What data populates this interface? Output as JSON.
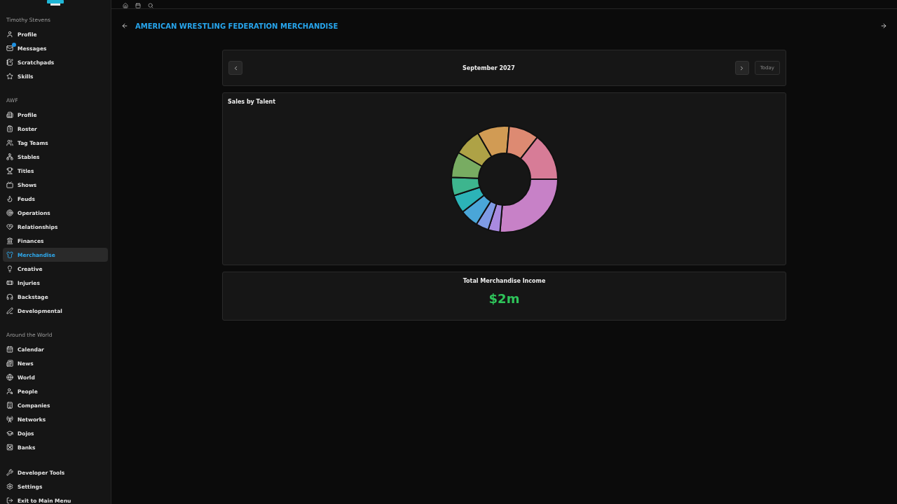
{
  "sidebar": {
    "sections": [
      {
        "title": "Timothy Stevens",
        "items": [
          {
            "label": "Profile",
            "selected": false
          },
          {
            "label": "Messages",
            "selected": false,
            "badge": true
          },
          {
            "label": "Scratchpads",
            "selected": false
          },
          {
            "label": "Skills",
            "selected": false
          }
        ]
      },
      {
        "title": "AWF",
        "items": [
          {
            "label": "Profile",
            "selected": false
          },
          {
            "label": "Roster",
            "selected": false
          },
          {
            "label": "Tag Teams",
            "selected": false
          },
          {
            "label": "Stables",
            "selected": false
          },
          {
            "label": "Titles",
            "selected": false
          },
          {
            "label": "Shows",
            "selected": false
          },
          {
            "label": "Feuds",
            "selected": false
          },
          {
            "label": "Operations",
            "selected": false
          },
          {
            "label": "Relationships",
            "selected": false
          },
          {
            "label": "Finances",
            "selected": false
          },
          {
            "label": "Merchandise",
            "selected": true
          },
          {
            "label": "Creative",
            "selected": false
          },
          {
            "label": "Injuries",
            "selected": false
          },
          {
            "label": "Backstage",
            "selected": false
          },
          {
            "label": "Developmental",
            "selected": false
          }
        ]
      },
      {
        "title": "Around the World",
        "items": [
          {
            "label": "Calendar",
            "selected": false
          },
          {
            "label": "News",
            "selected": false
          },
          {
            "label": "World",
            "selected": false
          },
          {
            "label": "People",
            "selected": false
          },
          {
            "label": "Companies",
            "selected": false
          },
          {
            "label": "Networks",
            "selected": false
          },
          {
            "label": "Dojos",
            "selected": false
          },
          {
            "label": "Banks",
            "selected": false
          }
        ]
      },
      {
        "items": [
          {
            "label": "Developer Tools",
            "selected": false
          },
          {
            "label": "Settings",
            "selected": false
          },
          {
            "label": "Exit to Main Menu",
            "selected": false
          }
        ]
      }
    ]
  },
  "page_title": "AMERICAN WRESTLING FEDERATION MERCHANDISE",
  "month_nav": {
    "month": "September 2027",
    "today_button": "Today"
  },
  "sales_card": {
    "title": "Sales by Talent"
  },
  "income_card": {
    "title": "Total Merchandise Income",
    "value": "$2m"
  }
}
